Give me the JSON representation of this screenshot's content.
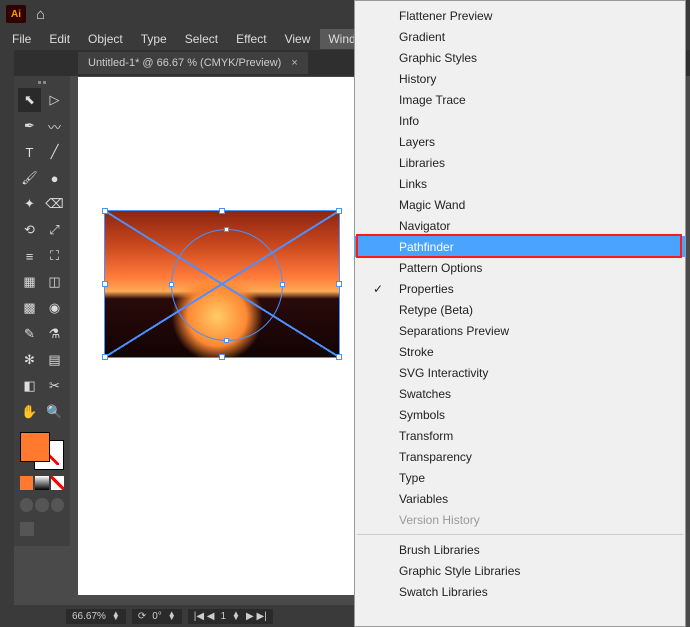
{
  "menu": [
    "File",
    "Edit",
    "Object",
    "Type",
    "Select",
    "Effect",
    "View",
    "Window"
  ],
  "tab": {
    "label": "Untitled-1* @ 66.67 % (CMYK/Preview)"
  },
  "status": {
    "zoom": "66.67%",
    "angle": "0°",
    "artboard": "1"
  },
  "window_menu": {
    "items": [
      {
        "label": "Flattener Preview"
      },
      {
        "label": "Gradient"
      },
      {
        "label": "Graphic Styles"
      },
      {
        "label": "History"
      },
      {
        "label": "Image Trace"
      },
      {
        "label": "Info"
      },
      {
        "label": "Layers"
      },
      {
        "label": "Libraries"
      },
      {
        "label": "Links"
      },
      {
        "label": "Magic Wand"
      },
      {
        "label": "Navigator"
      },
      {
        "label": "Pathfinder",
        "highlighted": true,
        "red_box": true
      },
      {
        "label": "Pattern Options"
      },
      {
        "label": "Properties",
        "checked": true
      },
      {
        "label": "Retype (Beta)"
      },
      {
        "label": "Separations Preview"
      },
      {
        "label": "Stroke"
      },
      {
        "label": "SVG Interactivity"
      },
      {
        "label": "Swatches"
      },
      {
        "label": "Symbols"
      },
      {
        "label": "Transform"
      },
      {
        "label": "Transparency"
      },
      {
        "label": "Type"
      },
      {
        "label": "Variables"
      },
      {
        "label": "Version History",
        "disabled": true
      }
    ],
    "libs": [
      {
        "label": "Brush Libraries"
      },
      {
        "label": "Graphic Style Libraries"
      },
      {
        "label": "Swatch Libraries"
      }
    ]
  },
  "tools": [
    [
      "selection",
      "direct-selection"
    ],
    [
      "pen",
      "curvature"
    ],
    [
      "type",
      "line"
    ],
    [
      "brush",
      "blob-brush"
    ],
    [
      "shaper",
      "eraser"
    ],
    [
      "rotate",
      "scale"
    ],
    [
      "width",
      "free-transform"
    ],
    [
      "shape-builder",
      "perspective"
    ],
    [
      "mesh",
      "gradient"
    ],
    [
      "eyedropper",
      "blend"
    ],
    [
      "symbol-sprayer",
      "graph"
    ],
    [
      "artboard",
      "slice"
    ],
    [
      "hand",
      "zoom"
    ]
  ]
}
